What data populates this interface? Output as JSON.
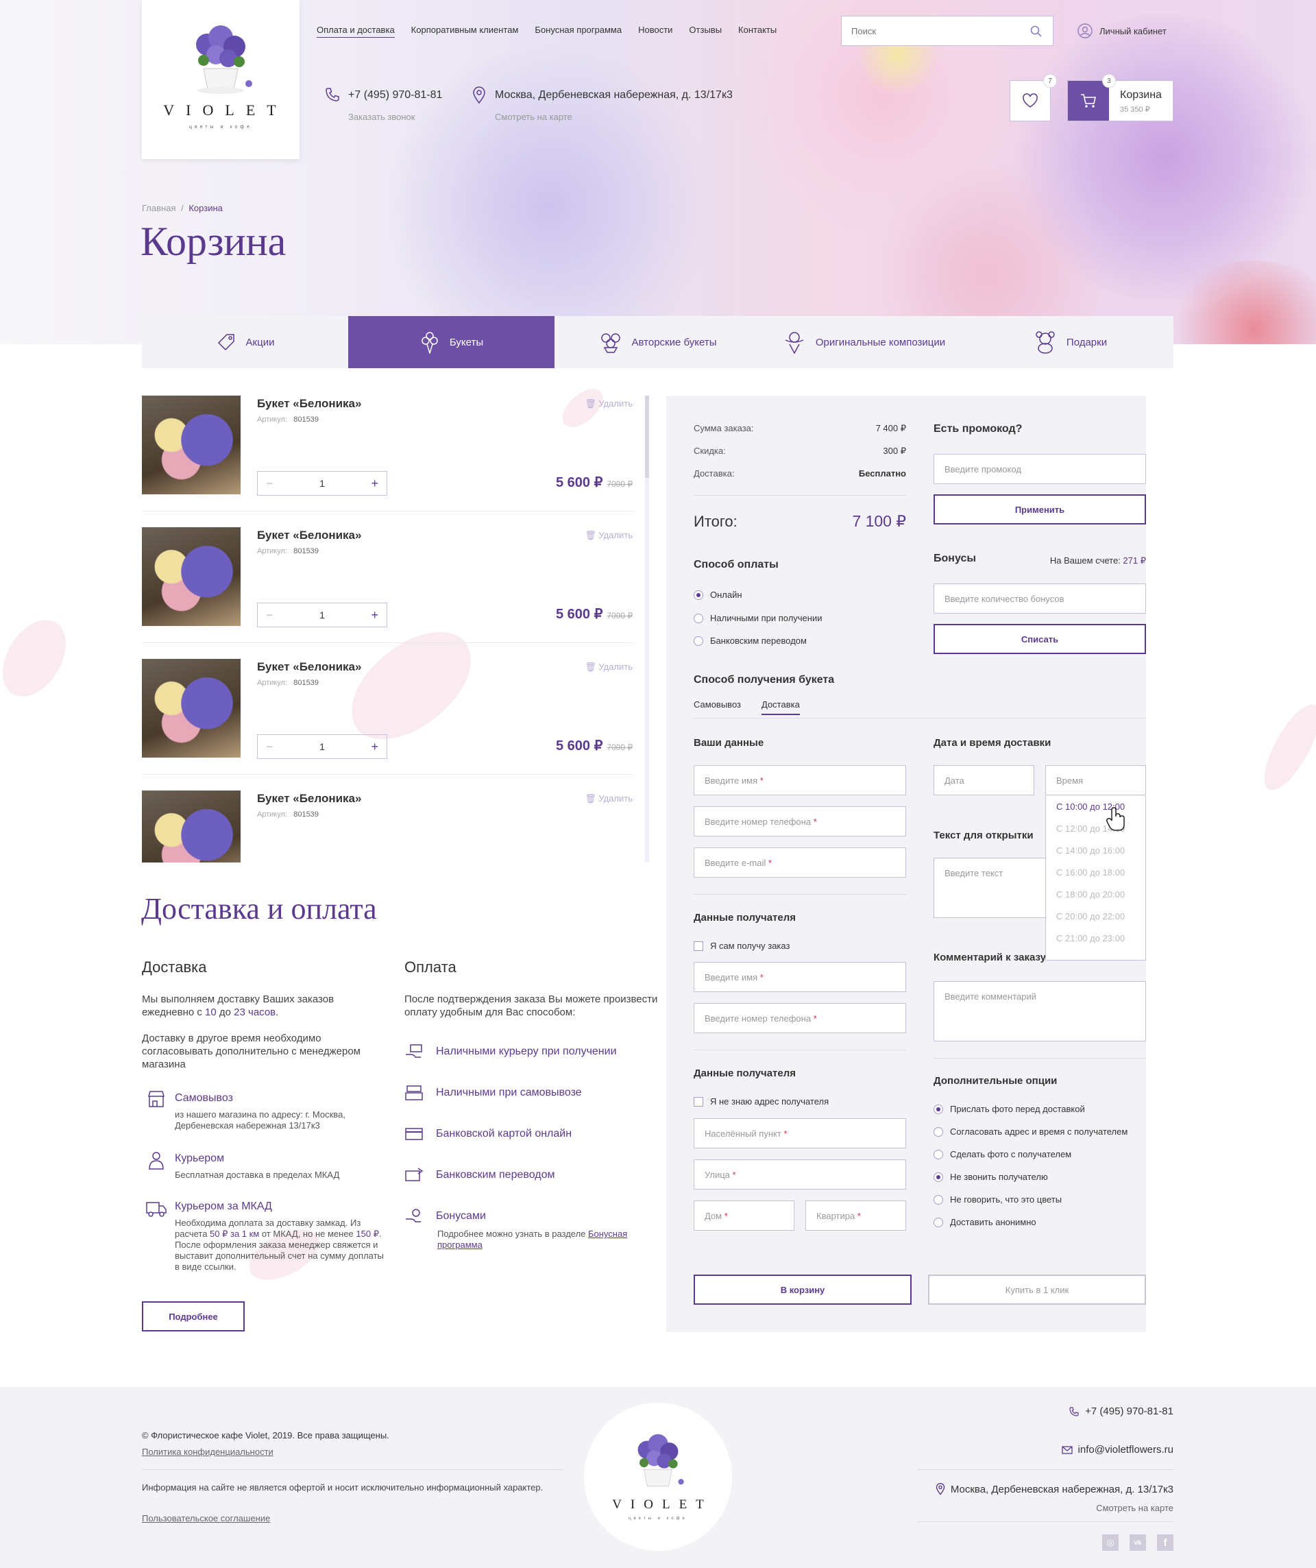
{
  "brand": {
    "name": "VIOLET",
    "tagline": "цветы и кофе"
  },
  "nav": {
    "items": [
      "Оплата и доставка",
      "Корпоративным клиентам",
      "Бонусная программа",
      "Новости",
      "Отзывы",
      "Контакты"
    ]
  },
  "search": {
    "placeholder": "Поиск"
  },
  "account": {
    "label": "Личный кабинет"
  },
  "contact": {
    "phone": "+7 (495) 970-81-81",
    "callback": "Заказать звонок",
    "address": "Москва, Дербеневская набережная, д. 13/17к3",
    "map": "Смотреть на карте"
  },
  "favorites": {
    "count": "7"
  },
  "cart_widget": {
    "count": "3",
    "title": "Корзина",
    "sum": "35 350 ₽"
  },
  "breadcrumb": {
    "home": "Главная",
    "sep": "/",
    "current": "Корзина"
  },
  "page_title": "Корзина",
  "categories": [
    "Акции",
    "Букеты",
    "Авторские букеты",
    "Оригинальные композиции",
    "Подарки"
  ],
  "cart": {
    "delete_label": "Удалить",
    "art_label": "Артикул:",
    "items": [
      {
        "name": "Букет «Белоника»",
        "art": "801539",
        "qty": "1",
        "price": "5 600 ₽",
        "old_price": "7000 ₽"
      },
      {
        "name": "Букет «Белоника»",
        "art": "801539",
        "qty": "1",
        "price": "5 600 ₽",
        "old_price": "7000 ₽"
      },
      {
        "name": "Букет «Белоника»",
        "art": "801539",
        "qty": "1",
        "price": "5 600 ₽",
        "old_price": "7000 ₽"
      },
      {
        "name": "Букет «Белоника»",
        "art": "801539"
      }
    ]
  },
  "summary": {
    "sum_label": "Сумма заказа:",
    "sum": "7 400 ₽",
    "discount_label": "Скидка:",
    "discount": "300 ₽",
    "delivery_label": "Доставка:",
    "delivery": "Бесплатно",
    "total_label": "Итого:",
    "total": "7 100 ₽"
  },
  "promo": {
    "title": "Есть промокод?",
    "placeholder": "Введите промокод",
    "apply": "Применить"
  },
  "bonus": {
    "title": "Бонусы",
    "account_label": "На Вашем счете:",
    "account_value": "271 ₽",
    "placeholder": "Введите количество бонусов",
    "write_off": "Списать"
  },
  "payment": {
    "title": "Способ оплаты",
    "options": [
      "Онлайн",
      "Наличными при получении",
      "Банковским переводом"
    ]
  },
  "receive": {
    "title": "Способ  получения букета",
    "tabs": [
      "Самовывоз",
      "Доставка"
    ]
  },
  "your_data": {
    "title": "Ваши данные",
    "name": "Введите имя",
    "phone": "Введите номер телефона",
    "email": "Введите e-mail"
  },
  "recipient": {
    "title": "Данные получателя",
    "self": "Я сам получу заказ",
    "name": "Введите имя",
    "phone": "Введите номер телефона"
  },
  "recipient_address": {
    "title": "Данные получателя",
    "unknown": "Я не знаю адрес получателя",
    "city": "Населённый пункт",
    "street": "Улица",
    "house": "Дом",
    "flat": "Квартира"
  },
  "req_mark": "*",
  "datetime": {
    "title": "Дата и время доставки",
    "date": "Дата",
    "time": "Время",
    "slots": [
      "С 10:00 до 12:00",
      "С 12:00 до 14:00",
      "С 14:00 до 16:00",
      "С 16:00 до 18:00",
      "С 18:00 до 20:00",
      "С 20:00 до 22:00",
      "С 21:00 до 23:00"
    ]
  },
  "card_text": {
    "title": "Текст для открытки",
    "placeholder": "Введите текст"
  },
  "comment": {
    "title": "Комментарий к заказу",
    "placeholder": "Введите комментарий"
  },
  "extra": {
    "title": "Дополнительные опции",
    "options": [
      "Прислать фото перед доставкой",
      "Согласовать адрес и время с получателем",
      "Сделать фото с получателем",
      "Не звонить получателю",
      "Не говорить, что это цветы",
      "Доставить анонимно"
    ]
  },
  "actions": {
    "to_cart": "В корзину",
    "one_click": "Купить в 1 клик"
  },
  "delivery_info": {
    "title": "Доставка и оплата",
    "delivery_title": "Доставка",
    "text1_a": "Мы выполняем доставку Ваших заказов ежедневно с ",
    "text1_from": "10",
    "text1_b": " до ",
    "text1_to": "23 часов",
    "text1_c": ".",
    "text2": "Доставку в другое время необходимо согласовывать дополнительно с менеджером магазина",
    "pickup_title": "Самовывоз",
    "pickup_text": "из нашего магазина по адресу: г. Москва, Дербеневская набережная 13/17к3",
    "courier_title": "Курьером",
    "courier_text": "Бесплатная доставка в пределах МКАД",
    "mkad_title": "Курьером за МКАД",
    "mkad_a": "Необходима доплата за доставку замкад. Из расчета ",
    "mkad_rate": "50 ₽ за 1 км",
    "mkad_b": " от МКАД, но не менее ",
    "mkad_min": "150 ₽",
    "mkad_c": ". После оформления заказа менеджер свяжется и выставит дополнительный счет на сумму доплаты в виде ссылки.",
    "more": "Подробнее",
    "pay_title": "Оплата",
    "pay_text": "После подтверждения заказа Вы можете произвести оплату удобным для Вас способом:",
    "pay_methods": [
      "Наличными курьеру при получении",
      "Наличными при самовывозе",
      "Банковской картой онлайн",
      "Банковским переводом",
      "Бонусами"
    ],
    "bonus_note": "Подробнее можно узнать в разделе ",
    "bonus_link": "Бонусная программа"
  },
  "footer": {
    "copyright": "© Флористическое кафе Violet, 2019. Все права защищены.",
    "privacy": "Политика конфиденциальности",
    "disclaimer": "Информация на сайте не является офертой и носит исключительно информационный характер.",
    "agreement": "Пользовательское соглашение",
    "phone": "+7 (495) 970-81-81",
    "email": "info@violetflowers.ru",
    "address": "Москва, Дербеневская набережная, д. 13/17к3",
    "map": "Смотреть на карте"
  }
}
